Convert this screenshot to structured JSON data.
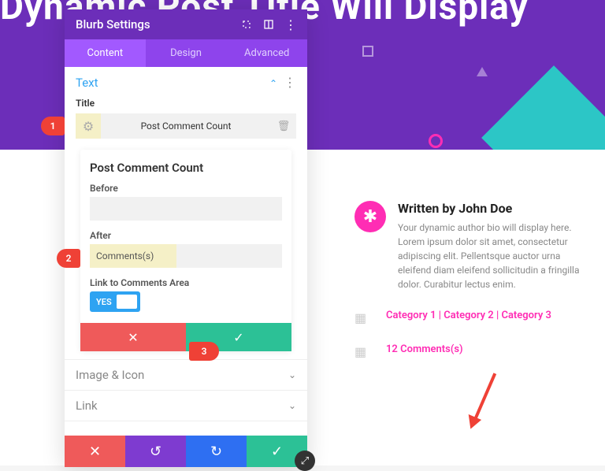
{
  "hero": {
    "title": "Dynamic Post Title Will Display"
  },
  "panel": {
    "title": "Blurb Settings",
    "tabs": {
      "content": "Content",
      "design": "Design",
      "advanced": "Advanced"
    },
    "sections": {
      "text": "Text",
      "image_icon": "Image & Icon",
      "link": "Link"
    },
    "title_field": {
      "label": "Title",
      "value": "Post Comment Count"
    },
    "subpanel": {
      "heading": "Post Comment Count",
      "before_label": "Before",
      "before_value": "",
      "after_label": "After",
      "after_value": "Comments(s)",
      "link_label": "Link to Comments Area",
      "toggle_text": "YES"
    }
  },
  "markers": {
    "m1": "1",
    "m2": "2",
    "m3": "3"
  },
  "right": {
    "author_title": "Written by John Doe",
    "author_bio": "Your dynamic author bio will display here. Lorem ipsum dolor sit amet, consectetur adipiscing elit. Pellentsque auctor urna eleifend diam eleifend sollicitudin a fringilla dolor. Curabitur lectus enim.",
    "categories": "Category 1 | Category 2 | Category 3",
    "comments": "12 Comments(s)"
  }
}
